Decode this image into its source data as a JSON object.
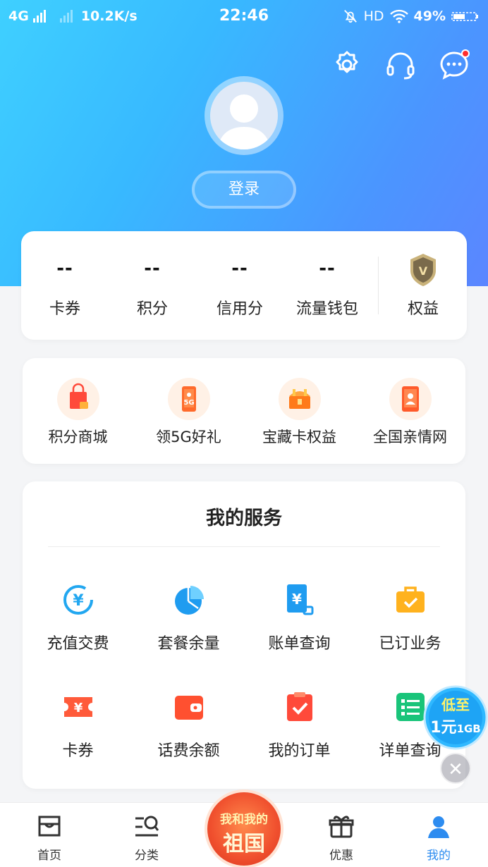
{
  "status_bar": {
    "network": "4G",
    "speed": "10.2K/s",
    "time": "22:46",
    "hd": "HD",
    "battery": "49%"
  },
  "header": {
    "icons": [
      "gear-icon",
      "headset-icon",
      "message-icon"
    ],
    "login_label": "登录"
  },
  "stats": [
    {
      "value": "--",
      "label": "卡券"
    },
    {
      "value": "--",
      "label": "积分"
    },
    {
      "value": "--",
      "label": "信用分"
    },
    {
      "value": "--",
      "label": "流量钱包"
    }
  ],
  "benefits_label": "权益",
  "quick_links": [
    {
      "label": "积分商城",
      "icon": "shopping-bag-icon"
    },
    {
      "label": "领5G好礼",
      "icon": "5g-phone-icon"
    },
    {
      "label": "宝藏卡权益",
      "icon": "treasure-chest-icon"
    },
    {
      "label": "全国亲情网",
      "icon": "family-network-icon"
    }
  ],
  "services": {
    "title": "我的服务",
    "items": [
      {
        "label": "充值交费",
        "icon": "recharge-icon"
      },
      {
        "label": "套餐余量",
        "icon": "pie-chart-icon"
      },
      {
        "label": "账单查询",
        "icon": "bill-icon"
      },
      {
        "label": "已订业务",
        "icon": "briefcase-icon"
      },
      {
        "label": "卡券",
        "icon": "coupon-icon"
      },
      {
        "label": "话费余额",
        "icon": "wallet-icon"
      },
      {
        "label": "我的订单",
        "icon": "order-clipboard-icon"
      },
      {
        "label": "详单查询",
        "icon": "list-icon"
      }
    ]
  },
  "promo": {
    "line1": "低至",
    "line2": "1元",
    "line3": "1GB"
  },
  "tabbar": {
    "tabs": [
      {
        "label": "首页",
        "icon": "home-icon"
      },
      {
        "label": "分类",
        "icon": "category-search-icon"
      },
      {
        "label": "优惠",
        "icon": "gift-icon"
      },
      {
        "label": "我的",
        "icon": "user-icon"
      }
    ],
    "center": {
      "line1": "我和我的",
      "line2": "祖国"
    }
  },
  "colors": {
    "accent": "#2d8cf0",
    "hero_start": "#3fd0ff",
    "hero_end": "#5b86ff",
    "orange": "#ff6a2b"
  }
}
